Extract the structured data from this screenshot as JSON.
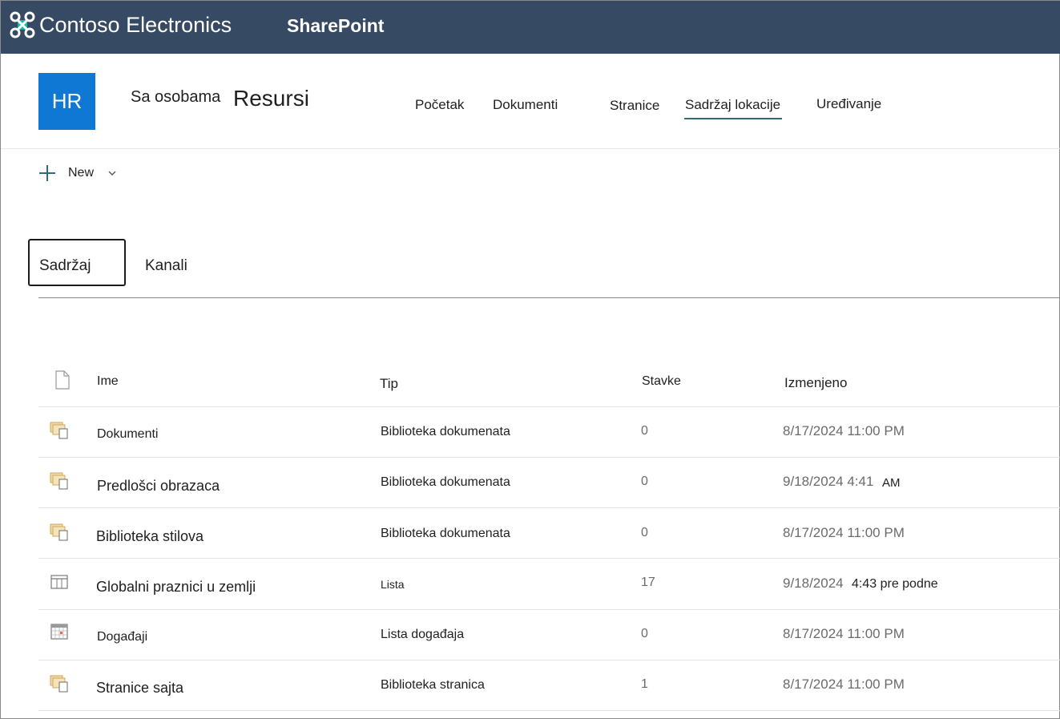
{
  "topbar": {
    "brand": "Contoso Electronics",
    "app": "SharePoint",
    "brand_icon": "contoso-logo-icon"
  },
  "site": {
    "logo": "HR",
    "pre_title": "Sa osobama",
    "title": "Resursi",
    "nav": [
      "Početak",
      "Dokumenti",
      "Stranice",
      "Sadržaj lokacije",
      "Uređivanje"
    ],
    "nav_active": "Sadržaj lokacije",
    "accent": "#2f6b73",
    "logo_color": "#0f78d4"
  },
  "command": {
    "new_label": "New"
  },
  "tabs": [
    "Sadržaj",
    "Kanali"
  ],
  "tabs_active": "Sadržaj",
  "table": {
    "headers": [
      "Ime",
      "Tip",
      "Stavke",
      "Izmenjeno"
    ],
    "rows": [
      {
        "name": "Dokumenti",
        "type": "Biblioteka dokumenata",
        "items": "0",
        "date": "8/17/2024 11:00 PM",
        "icon": "library-icon"
      },
      {
        "name": "Predlošci obrazaca",
        "type": "Biblioteka dokumenata",
        "items": "0",
        "date": "9/18/2024 4:41",
        "date_suffix": "AM",
        "icon": "library-icon"
      },
      {
        "name": "Biblioteka stilova",
        "type": "Biblioteka dokumenata",
        "items": "0",
        "date": "8/17/2024 11:00 PM",
        "icon": "library-icon"
      },
      {
        "name": "Globalni praznici u zemlji",
        "type": "Lista",
        "items": "17",
        "date": "9/18/2024",
        "date_suffix": "4:43 pre podne",
        "icon": "list-icon"
      },
      {
        "name": "Događaji",
        "type": "Lista događaja",
        "items": "0",
        "date": "8/17/2024 11:00 PM",
        "icon": "calendar-icon"
      },
      {
        "name": "Stranice sajta",
        "type": "Biblioteka stranica",
        "items": "1",
        "date": "8/17/2024 11:00 PM",
        "icon": "library-icon"
      }
    ]
  }
}
